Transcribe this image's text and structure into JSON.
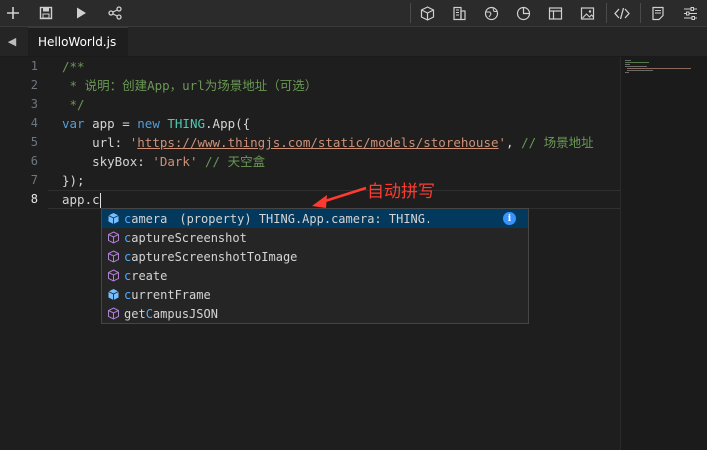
{
  "toolbar": {
    "left_icons": [
      "add-icon",
      "save-icon",
      "run-icon",
      "share-icon"
    ],
    "right_icons": [
      "cube-icon",
      "building-icon",
      "globe-icon",
      "chart-icon",
      "layout-icon",
      "image-icon",
      "code-icon",
      "notes-icon",
      "settings-sliders-icon"
    ]
  },
  "tabs": [
    {
      "label": "HelloWorld.js",
      "active": true
    }
  ],
  "editor": {
    "line_numbers": [
      "1",
      "2",
      "3",
      "4",
      "5",
      "6",
      "7",
      "8"
    ],
    "active_line": "8",
    "lines": {
      "l1": "/**",
      "l2": " * 说明：创建App，url为场景地址（可选）",
      "l3": " */",
      "l4_kw_var": "var",
      "l4_app": " app = ",
      "l4_kw_new": "new",
      "l4_thing": "THING",
      "l4_rest": ".App({",
      "l5_key": "    url: ",
      "l5_q1": "'",
      "l5_url": "https://www.thingjs.com/static/models/storehouse",
      "l5_q2": "'",
      "l5_sep": ", ",
      "l5_comment": "// 场景地址",
      "l6_key": "    skyBox: ",
      "l6_val": "'Dark'",
      "l6_sp": " ",
      "l6_comment": "// 天空盒",
      "l7": "});",
      "l8": "app.c"
    }
  },
  "suggestions": [
    {
      "hl": "c",
      "rest": "amera",
      "prefix": "",
      "detail": "(property) THING.App.camera: THING.Camer…",
      "icon": "property-icon",
      "selected": true
    },
    {
      "hl": "c",
      "rest": "aptureScreenshot",
      "prefix": "",
      "icon": "method-icon"
    },
    {
      "hl": "c",
      "rest": "aptureScreenshotToImage",
      "prefix": "",
      "icon": "method-icon"
    },
    {
      "hl": "c",
      "rest": "reate",
      "prefix": "",
      "icon": "method-icon"
    },
    {
      "hl": "c",
      "rest": "urrentFrame",
      "prefix": "",
      "icon": "property-icon"
    },
    {
      "prefix": "get",
      "hl": "C",
      "rest": "ampusJSON",
      "icon": "method-icon"
    }
  ],
  "annotation": {
    "text": "自动拼写",
    "color": "#ff3b30"
  },
  "colors": {
    "accent": "#3794ff",
    "selection": "#04395e",
    "comment": "#6a9955",
    "keyword": "#569cd6",
    "string": "#ce9178"
  }
}
